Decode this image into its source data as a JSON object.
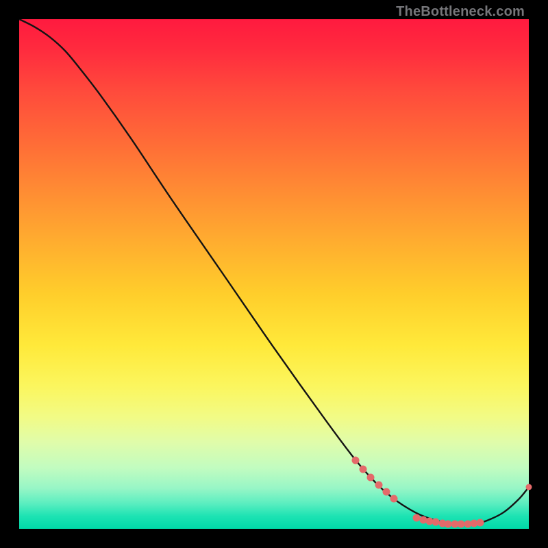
{
  "watermark": "TheBottleneck.com",
  "colors": {
    "dot": "#e46a6a",
    "curve": "#141414"
  },
  "chart_data": {
    "type": "line",
    "title": "",
    "xlabel": "",
    "ylabel": "",
    "xlim": [
      0,
      100
    ],
    "ylim": [
      0,
      100
    ],
    "grid": false,
    "series": [
      {
        "name": "curve",
        "x": [
          0,
          3,
          6,
          9,
          12,
          16,
          22,
          30,
          40,
          50,
          60,
          66,
          70,
          73,
          76,
          79,
          82,
          85,
          88,
          90,
          92,
          95,
          98,
          100
        ],
        "y": [
          100,
          98.5,
          96.5,
          93.8,
          90.2,
          85.0,
          76.5,
          64.5,
          50.0,
          35.5,
          21.5,
          13.5,
          9.0,
          6.3,
          4.2,
          2.6,
          1.6,
          1.0,
          0.9,
          1.1,
          1.7,
          3.2,
          5.8,
          8.2
        ]
      }
    ],
    "highlight_clusters": [
      {
        "name": "upper-slope-cluster",
        "points": [
          {
            "x": 66.0,
            "y": 13.5
          },
          {
            "x": 67.5,
            "y": 11.7
          },
          {
            "x": 69.0,
            "y": 10.1
          },
          {
            "x": 70.5,
            "y": 8.6
          },
          {
            "x": 72.0,
            "y": 7.2
          },
          {
            "x": 73.5,
            "y": 5.9
          }
        ]
      },
      {
        "name": "trough-cluster",
        "points": [
          {
            "x": 78.0,
            "y": 2.2
          },
          {
            "x": 79.3,
            "y": 1.8
          },
          {
            "x": 80.5,
            "y": 1.5
          },
          {
            "x": 81.7,
            "y": 1.3
          },
          {
            "x": 83.0,
            "y": 1.1
          },
          {
            "x": 84.2,
            "y": 1.0
          },
          {
            "x": 85.5,
            "y": 0.95
          },
          {
            "x": 86.7,
            "y": 0.92
          },
          {
            "x": 88.0,
            "y": 0.95
          },
          {
            "x": 89.3,
            "y": 1.05
          },
          {
            "x": 90.5,
            "y": 1.25
          }
        ]
      },
      {
        "name": "end-point",
        "points": [
          {
            "x": 100.0,
            "y": 8.2
          }
        ]
      }
    ]
  }
}
